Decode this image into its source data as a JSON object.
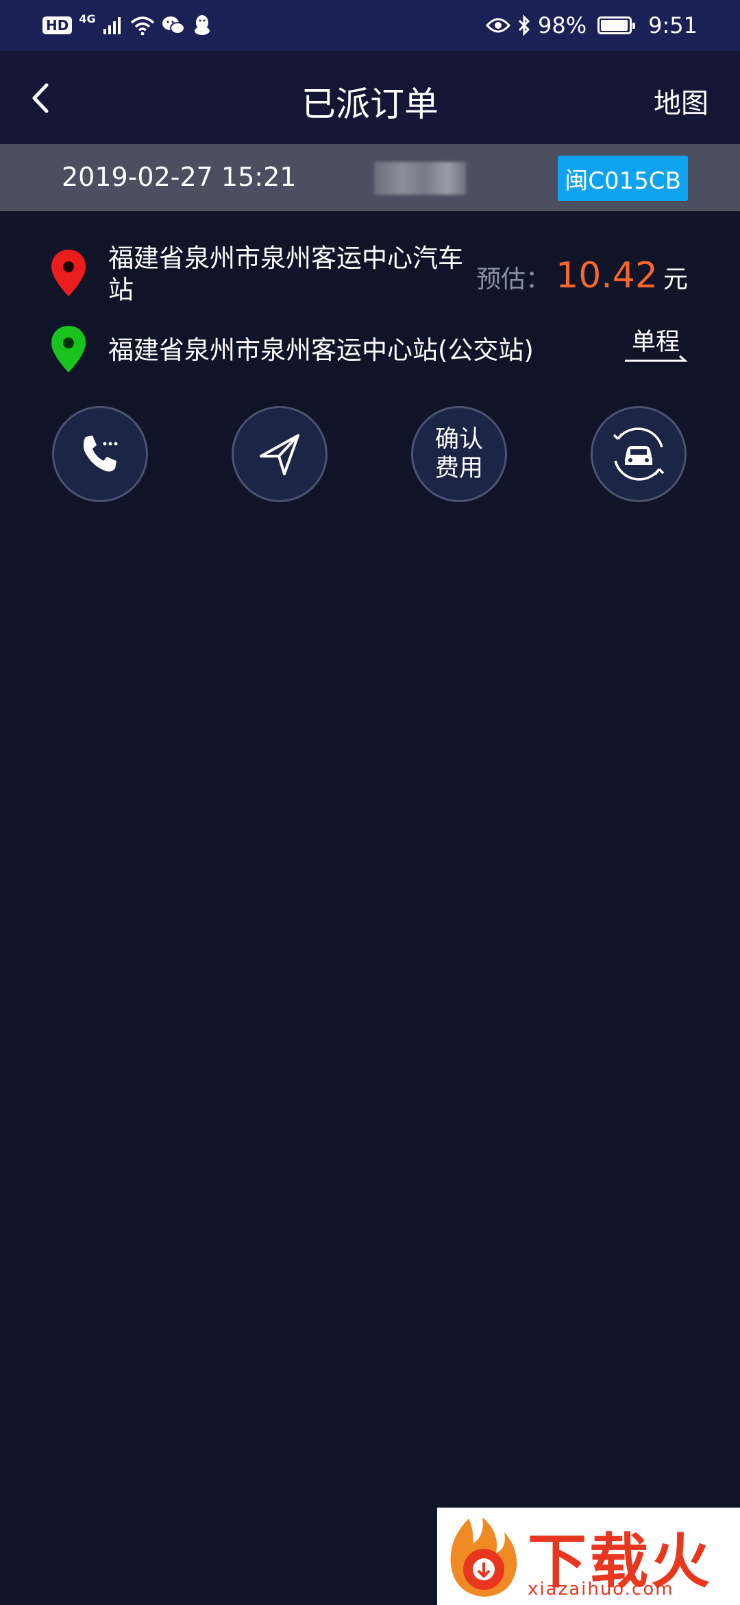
{
  "status_bar": {
    "hd": "HD",
    "network": "4G",
    "battery": "98%",
    "battery_level": 0.98,
    "time": "9:51",
    "icons": [
      "hd-icon",
      "signal-icon",
      "wifi-icon",
      "wechat-icon",
      "qq-icon",
      "eye-icon",
      "bluetooth-icon",
      "battery-icon"
    ]
  },
  "nav": {
    "title": "已派订单",
    "map_link": "地图",
    "back_icon": "chevron-left-icon"
  },
  "order": {
    "time": "2019-02-27 15:21",
    "plate": "闽C015CB",
    "plate_color": "#0da3f0"
  },
  "route": {
    "pickup": "福建省泉州市泉州客运中心汽车站",
    "dropoff": "福建省泉州市泉州客运中心站(公交站)",
    "pickup_pin_color": "#ea1c1c",
    "dropoff_pin_color": "#19c21c"
  },
  "estimate": {
    "label": "预估：",
    "value": "10.42",
    "unit": "元",
    "value_color": "#f5672a"
  },
  "trip_type": "单程",
  "actions": {
    "call_icon": "phone-icon",
    "navigate_icon": "navigation-arrow-icon",
    "confirm_fee": "确认\n费用",
    "confirm_fee_line1": "确认",
    "confirm_fee_line2": "费用",
    "car_icon": "car-refresh-icon"
  },
  "watermark": {
    "brand": "下载火",
    "url": "xiazaihuo.com"
  }
}
